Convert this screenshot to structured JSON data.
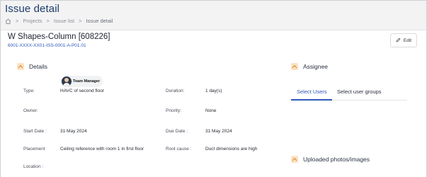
{
  "header": {
    "title": "Issue detail",
    "breadcrumb": [
      "Projects",
      "Issue list",
      "Issue detail"
    ],
    "separator": ">"
  },
  "issue": {
    "title": "W Shapes-Column [608226]",
    "code": "6001-XXXX-XX01-ISS-0001-A-P01.01",
    "edit_label": "Edit"
  },
  "details": {
    "heading": "Details",
    "type_label": "Type:",
    "type_value": "HAVC of second floor",
    "duration_label": "Duration:",
    "duration_value": "1 day(s)",
    "owner_label": "Owner:",
    "owner_value": "Team Manager",
    "priority_label": "Priority:",
    "priority_value": "None",
    "start_label": "Start Date :",
    "start_value": "31 May 2024",
    "due_label": "Due Date :",
    "due_value": "31 May 2024",
    "placement_label": "Placement",
    "placement_value": "Ceiling reference with room 1 in first floor",
    "root_label": "Root cause :",
    "root_value": "Duct dimensions are high",
    "location_label": "Location :"
  },
  "assignee": {
    "heading": "Assignee",
    "tabs": [
      "Select Users",
      "Select user groups"
    ]
  },
  "photos": {
    "heading": "Uploaded photos/images"
  },
  "colors": {
    "accent": "#2f58b8",
    "title": "#1d3b6b",
    "caret_bg": "#fbe3c5",
    "caret": "#e08a2e"
  },
  "icons": {
    "home": "home-icon",
    "edit": "pencil-icon",
    "collapse": "chevron-up-icon"
  }
}
